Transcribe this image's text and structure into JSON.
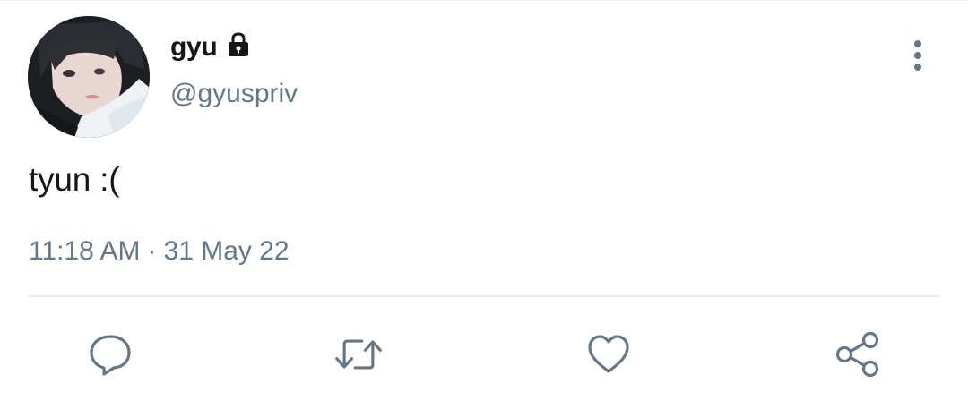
{
  "tweet": {
    "author": {
      "display_name": "gyu",
      "handle": "@gyuspriv",
      "protected": true,
      "avatar_icon": "profile-photo"
    },
    "text": "tyun :(",
    "time": "11:18 AM",
    "separator": "·",
    "date": "31 May 22"
  },
  "actions": [
    {
      "name": "reply",
      "icon": "speech-bubble-icon"
    },
    {
      "name": "retweet",
      "icon": "retweet-arrows-icon"
    },
    {
      "name": "like",
      "icon": "heart-icon"
    },
    {
      "name": "share",
      "icon": "share-nodes-icon"
    }
  ],
  "colors": {
    "text_primary": "#14171a",
    "text_secondary": "#657786",
    "divider": "#e6ecf0",
    "icon": "#657786"
  }
}
